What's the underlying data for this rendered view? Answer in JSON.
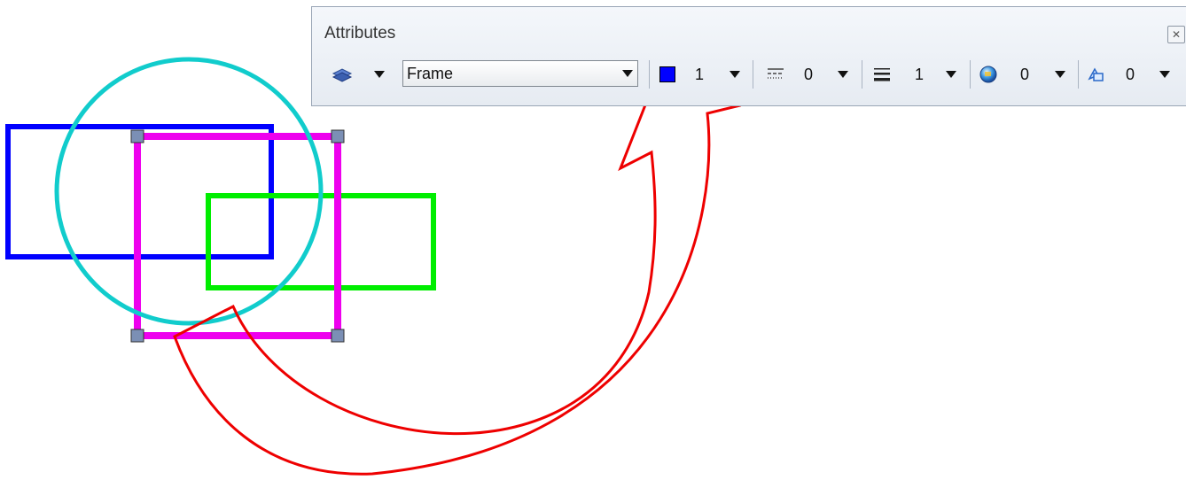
{
  "toolbar": {
    "title": "Attributes",
    "close_icon": "close-icon",
    "level_select": {
      "value": "Frame"
    },
    "color": {
      "value": "1",
      "swatch": "#0000ff"
    },
    "linestyle": {
      "value": "0"
    },
    "weight": {
      "value": "1"
    },
    "transparency": {
      "value": "0"
    },
    "priority": {
      "value": "0"
    }
  },
  "canvas": {
    "shapes": [
      {
        "kind": "rectangle",
        "color": "#0000ff"
      },
      {
        "kind": "rectangle",
        "color": "#ee00ee",
        "selected": true
      },
      {
        "kind": "rectangle",
        "color": "#00ee00"
      },
      {
        "kind": "circle",
        "color": "#00cccc"
      }
    ],
    "arrow_color": "#ee0000"
  }
}
